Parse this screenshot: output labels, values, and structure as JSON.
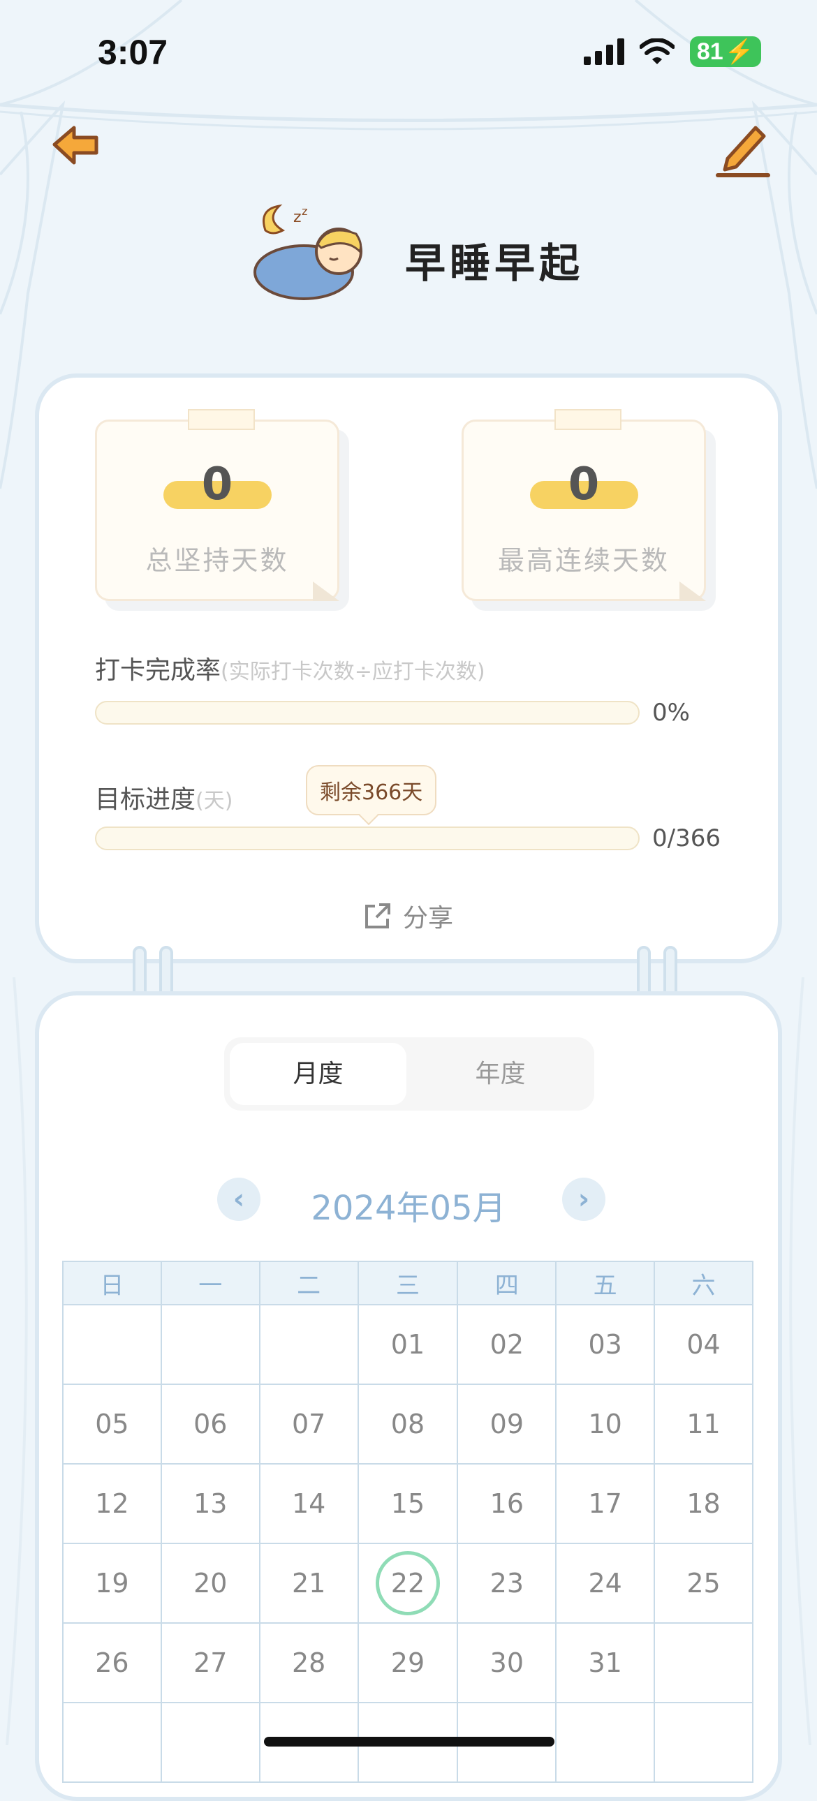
{
  "status_bar": {
    "time": "3:07",
    "battery": "81"
  },
  "header": {
    "title": "早睡早起"
  },
  "stats": [
    {
      "value": "0",
      "label": "总坚持天数"
    },
    {
      "value": "0",
      "label": "最高连续天数"
    }
  ],
  "completion": {
    "title": "打卡完成率",
    "subtitle": "(实际打卡次数÷应打卡次数)",
    "value": "0%",
    "progress": 0
  },
  "goal": {
    "title": "目标进度",
    "subtitle": "(天)",
    "value": "0/366",
    "tooltip": "剩余366天",
    "progress": 0
  },
  "share_label": "分享",
  "tabs": {
    "monthly": "月度",
    "yearly": "年度"
  },
  "calendar": {
    "month_label": "2024年05月",
    "weekdays": [
      "日",
      "一",
      "二",
      "三",
      "四",
      "五",
      "六"
    ],
    "weeks": [
      [
        "",
        "",
        "",
        "01",
        "02",
        "03",
        "04"
      ],
      [
        "05",
        "06",
        "07",
        "08",
        "09",
        "10",
        "11"
      ],
      [
        "12",
        "13",
        "14",
        "15",
        "16",
        "17",
        "18"
      ],
      [
        "19",
        "20",
        "21",
        "22",
        "23",
        "24",
        "25"
      ],
      [
        "26",
        "27",
        "28",
        "29",
        "30",
        "31",
        ""
      ],
      [
        "",
        "",
        "",
        "",
        "",
        "",
        ""
      ]
    ],
    "today": "22"
  },
  "colors": {
    "accent_yellow": "#f7d262",
    "calendar_blue": "#8db2d4",
    "today_ring": "#8fdcb6",
    "battery_green": "#3ec45a"
  },
  "icons": {
    "back": "arrow-left-icon",
    "edit": "pencil-icon",
    "share": "share-icon",
    "prev": "chevron-left-icon",
    "next": "chevron-right-icon"
  }
}
